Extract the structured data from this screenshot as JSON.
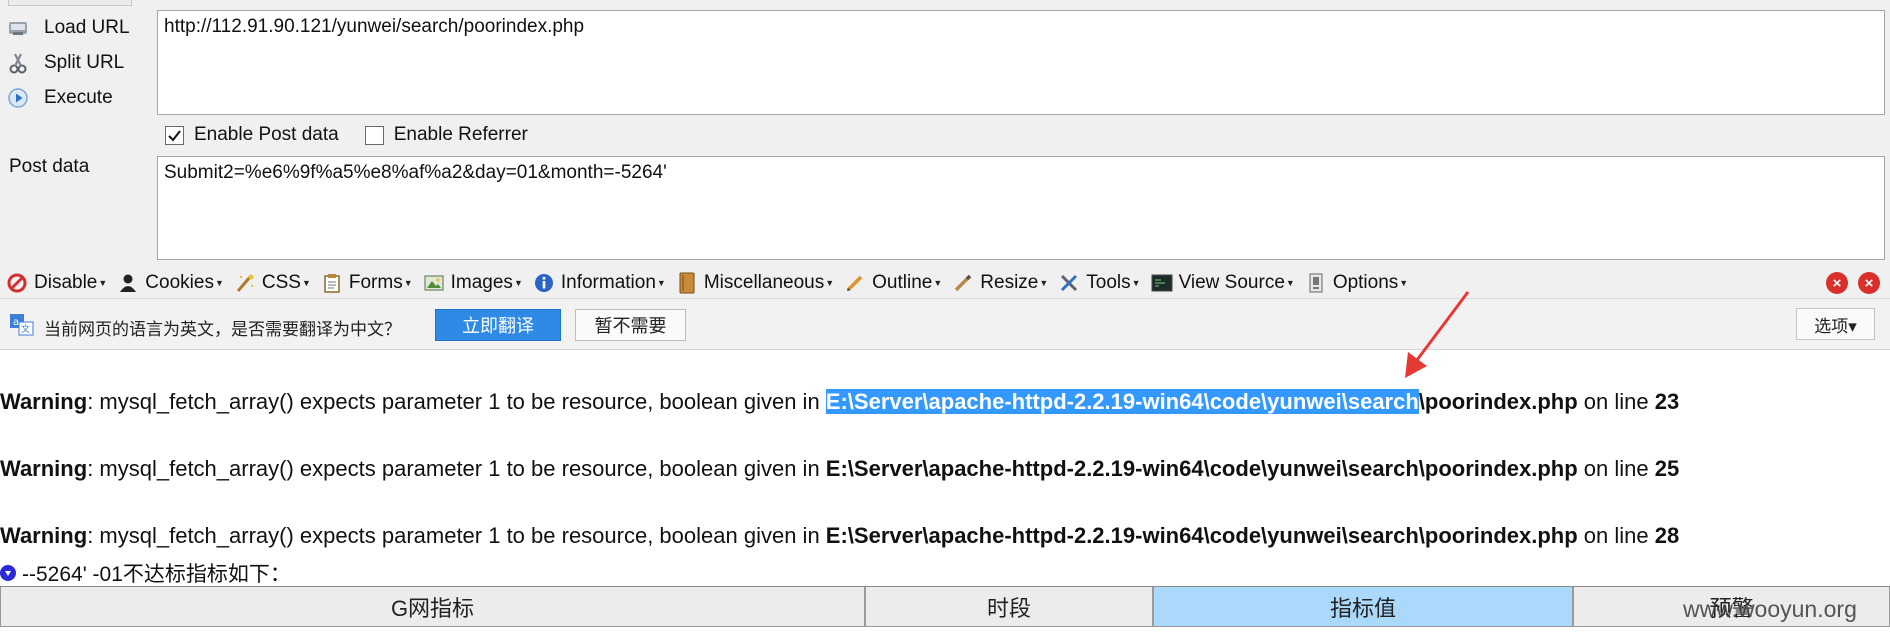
{
  "hackbar": {
    "load_url": "Load URL",
    "split_url": "Split URL",
    "execute": "Execute",
    "url_value": "http://112.91.90.121/yunwei/search/poorindex.php",
    "enable_post": "Enable Post data",
    "enable_post_checked": true,
    "enable_referrer": "Enable Referrer",
    "enable_referrer_checked": false,
    "post_label": "Post data",
    "post_value": "Submit2=%e6%9f%a5%e8%af%a2&day=01&month=-5264'"
  },
  "webdev": {
    "items": [
      {
        "label": "Disable",
        "icon": "disable-icon"
      },
      {
        "label": "Cookies",
        "icon": "cookies-icon"
      },
      {
        "label": "CSS",
        "icon": "css-icon"
      },
      {
        "label": "Forms",
        "icon": "forms-icon"
      },
      {
        "label": "Images",
        "icon": "images-icon"
      },
      {
        "label": "Information",
        "icon": "information-icon"
      },
      {
        "label": "Miscellaneous",
        "icon": "miscellaneous-icon"
      },
      {
        "label": "Outline",
        "icon": "outline-icon"
      },
      {
        "label": "Resize",
        "icon": "resize-icon"
      },
      {
        "label": "Tools",
        "icon": "tools-icon"
      },
      {
        "label": "View Source",
        "icon": "view-source-icon"
      },
      {
        "label": "Options",
        "icon": "options-icon"
      }
    ]
  },
  "translate": {
    "prompt": "当前网页的语言为英文，是否需要翻译为中文？",
    "translate_button": "立即翻译",
    "decline_button": "暂不需要",
    "options_button": "选项▾"
  },
  "warnings": [
    {
      "label": "Warning",
      "message": ": mysql_fetch_array() expects parameter 1 to be resource, boolean given in ",
      "path_selected": "E:\\Server\\apache-httpd-2.2.19-win64\\code\\yunwei\\search",
      "path_rest": "\\poorindex.php",
      "on_line": " on line ",
      "line": "23"
    },
    {
      "label": "Warning",
      "message": ": mysql_fetch_array() expects parameter 1 to be resource, boolean given in ",
      "path": "E:\\Server\\apache-httpd-2.2.19-win64\\code\\yunwei\\search\\poorindex.php",
      "on_line": " on line ",
      "line": "25"
    },
    {
      "label": "Warning",
      "message": ": mysql_fetch_array() expects parameter 1 to be resource, boolean given in ",
      "path": "E:\\Server\\apache-httpd-2.2.19-win64\\code\\yunwei\\search\\poorindex.php",
      "on_line": " on line ",
      "line": "28"
    }
  ],
  "result_line": "--5264' -01不达标指标如下：",
  "table": {
    "headers": [
      "G网指标",
      "时段",
      "指标值",
      "预警"
    ],
    "active_index": 2
  },
  "watermark": "www.wooyun.org",
  "colors": {
    "selection": "#3399ff",
    "translate_button": "#2f8ae6",
    "active_header": "#aad9fb",
    "close": "#d9302b",
    "annotation": "#e53935"
  }
}
